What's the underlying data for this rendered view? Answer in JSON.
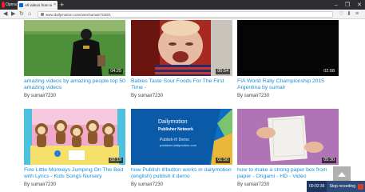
{
  "browser": {
    "menu_label": "Opera",
    "tab_title": "All videos from sumair7",
    "new_tab_symbol": "+",
    "window_controls": [
      "–",
      "❐",
      "✕"
    ],
    "url": "www.dailymotion.com/user/sumair7230/1",
    "url_tail": "",
    "nav_icons": [
      "back-icon",
      "forward-icon",
      "reload-icon",
      "home-icon"
    ],
    "right_icons": [
      "bookmark-heart-icon",
      "download-icon",
      "menu-icon"
    ]
  },
  "videos": [
    {
      "title": "amazing videos by amazing people top 50 amazing videos",
      "duration": "04:25",
      "by": "By",
      "author": "sumair7230"
    },
    {
      "title": "Babies Taste Sour Foods For The First Time -",
      "duration": "00:54",
      "by": "By",
      "author": "sumair7230"
    },
    {
      "title": "FIA World Rally Championship 2015 Argentina by sumair",
      "duration": "02:08",
      "by": "By",
      "author": "sumair7230"
    },
    {
      "title": "Five Little Monkeys Jumping On The Bed with Lyrics - Kids Songs Nursery",
      "duration": "02:19",
      "by": "By",
      "author": "sumair7230"
    },
    {
      "title": "how Publish it!button works in dailymotion (english) publish it demo",
      "duration": "01:50",
      "by": "By",
      "author": "sumair7230",
      "thumb_brand": "Dailymotion",
      "thumb_sub": "Publisher Network",
      "thumb_demo": "Publish-It! Demo",
      "thumb_url": "publisher.dailymotion.com"
    },
    {
      "title": "how to make a strong paper box from paper - Origami - HD - Video",
      "duration": "05:30",
      "by": "By",
      "author": "sumair7230"
    }
  ],
  "recorder": {
    "time": "00:02:36",
    "stop_label": "Stop recording"
  },
  "colors": {
    "link": "#1a8fd6",
    "browser_dark": "#2c2d30",
    "opera_red": "#ff1b2d"
  }
}
